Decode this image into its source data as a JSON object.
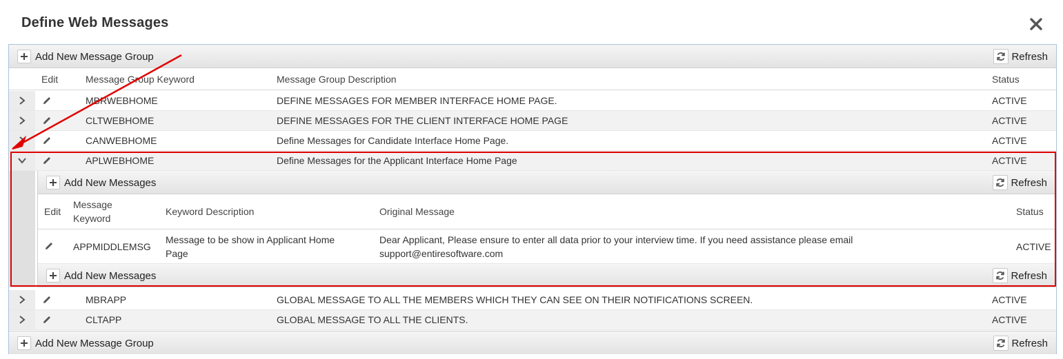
{
  "dialog": {
    "title": "Define Web Messages"
  },
  "toolbar": {
    "add_group_label": "Add New Message Group",
    "refresh_label": "Refresh"
  },
  "columns": {
    "edit": "Edit",
    "keyword": "Message Group Keyword",
    "description": "Message Group Description",
    "status": "Status"
  },
  "rows_before": [
    {
      "keyword": "MBRWEBHOME",
      "description": "DEFINE MESSAGES FOR MEMBER INTERFACE HOME PAGE.",
      "status": "ACTIVE"
    },
    {
      "keyword": "CLTWEBHOME",
      "description": "DEFINE MESSAGES FOR THE CLIENT INTERFACE HOME PAGE",
      "status": "ACTIVE"
    },
    {
      "keyword": "CANWEBHOME",
      "description": "Define Messages for Candidate Interface Home Page.",
      "status": "ACTIVE"
    },
    {
      "keyword": "APLWEBHOME",
      "description": "Define Messages for the Applicant Interface Home Page",
      "status": "ACTIVE"
    }
  ],
  "detail": {
    "add_messages_label": "Add New Messages",
    "refresh_label": "Refresh",
    "columns": {
      "edit": "Edit",
      "keyword_line1": "Message",
      "keyword_line2": "Keyword",
      "keyword_description": "Keyword Description",
      "original_message": "Original Message",
      "status": "Status"
    },
    "row": {
      "keyword": "APPMIDDLEMSG",
      "description_line1": "Message to be show in Applicant Home",
      "description_line2": "Page",
      "message_line1": "Dear Applicant, Please ensure to enter all data prior to your interview time. If you need assistance please email",
      "message_line2": "support@entiresoftware.com",
      "status": "ACTIVE"
    }
  },
  "rows_after": [
    {
      "keyword": "MBRAPP",
      "description": "GLOBAL MESSAGE TO ALL THE MEMBERS WHICH THEY CAN SEE ON THEIR NOTIFICATIONS SCREEN.",
      "status": "ACTIVE"
    },
    {
      "keyword": "CLTAPP",
      "description": "GLOBAL MESSAGE TO ALL THE CLIENTS.",
      "status": "ACTIVE"
    }
  ],
  "colors": {
    "highlight": "#e00000",
    "grid_border": "#a9c2db"
  }
}
